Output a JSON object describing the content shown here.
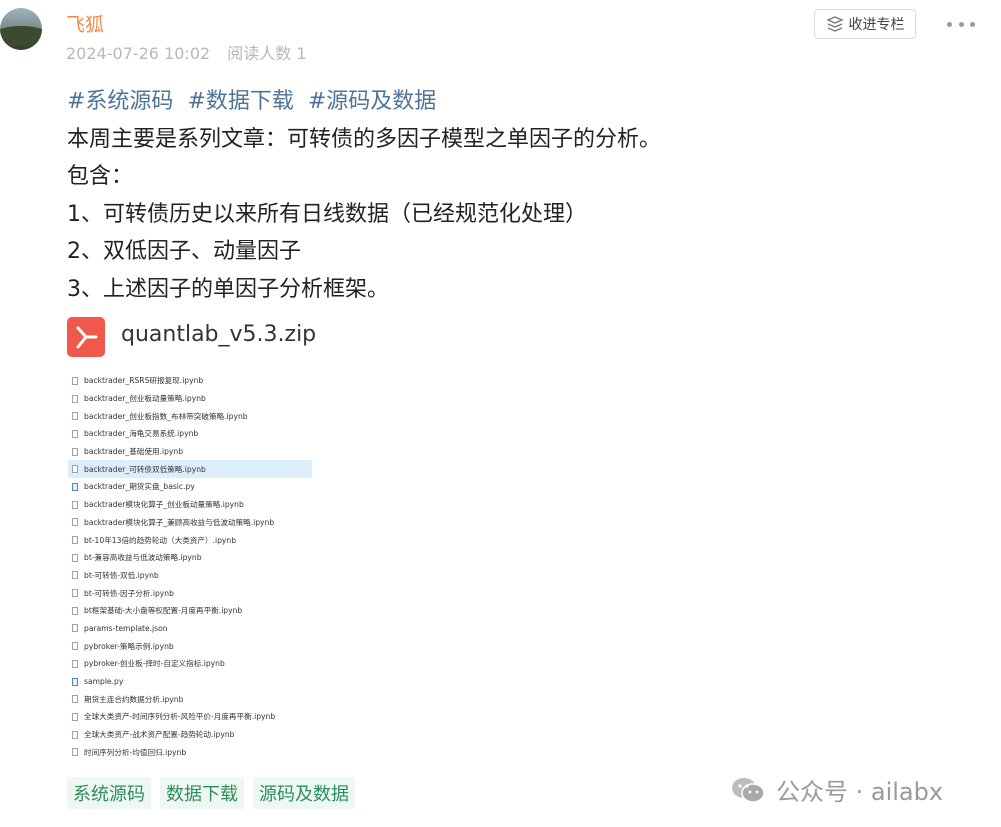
{
  "header": {
    "author": "飞狐",
    "date": "2024-07-26 10:02",
    "reads": "阅读人数 1",
    "collect_label": "收进专栏"
  },
  "post": {
    "topic_tags": [
      "#系统源码",
      "#数据下载",
      "#源码及数据"
    ],
    "lines": [
      "本周主要是系列文章：可转债的多因子模型之单因子的分析。",
      "包含：",
      "1、可转债历史以来所有日线数据（已经规范化处理）",
      "2、双低因子、动量因子",
      "3、上述因子的单因子分析框架。"
    ],
    "attachment": {
      "name": "quantlab_v5.3.zip"
    }
  },
  "file_list": [
    {
      "name": "backtrader_RSRS研报复现.ipynb",
      "type": "doc"
    },
    {
      "name": "backtrader_创业板动量策略.ipynb",
      "type": "doc"
    },
    {
      "name": "backtrader_创业板指数_布林带突破策略.ipynb",
      "type": "doc"
    },
    {
      "name": "backtrader_海龟交易系统.ipynb",
      "type": "doc"
    },
    {
      "name": "backtrader_基础使用.ipynb",
      "type": "doc"
    },
    {
      "name": "backtrader_可转债双低策略.ipynb",
      "type": "doc",
      "selected": true
    },
    {
      "name": "backtrader_期货实盘_basic.py",
      "type": "py"
    },
    {
      "name": "backtrader模块化算子_创业板动量策略.ipynb",
      "type": "doc"
    },
    {
      "name": "backtrader模块化算子_兼顾高收益与低波动策略.ipynb",
      "type": "doc"
    },
    {
      "name": "bt-10年13倍的趋势轮动（大类资产）.ipynb",
      "type": "doc"
    },
    {
      "name": "bt-兼容高收益与低波动策略.ipynb",
      "type": "doc"
    },
    {
      "name": "bt-可转债-双低.ipynb",
      "type": "doc"
    },
    {
      "name": "bt-可转债-因子分析.ipynb",
      "type": "doc"
    },
    {
      "name": "bt框架基础-大小盘等权配置-月度再平衡.ipynb",
      "type": "doc"
    },
    {
      "name": "params-template.json",
      "type": "doc"
    },
    {
      "name": "pybroker-策略示例.ipynb",
      "type": "doc"
    },
    {
      "name": "pybroker-创业板-择时-自定义指标.ipynb",
      "type": "doc"
    },
    {
      "name": "sample.py",
      "type": "py"
    },
    {
      "name": "期货主连合约数据分析.ipynb",
      "type": "doc"
    },
    {
      "name": "全球大类资产-时间序列分析-风险平价-月度再平衡.ipynb",
      "type": "doc"
    },
    {
      "name": "全球大类资产-战术资产配置-趋势轮动.ipynb",
      "type": "doc"
    },
    {
      "name": "时间序列分析-均值回归.ipynb",
      "type": "doc"
    }
  ],
  "bottom_tags": [
    "系统源码",
    "数据下载",
    "源码及数据"
  ],
  "watermark": "公众号 · ailabx"
}
